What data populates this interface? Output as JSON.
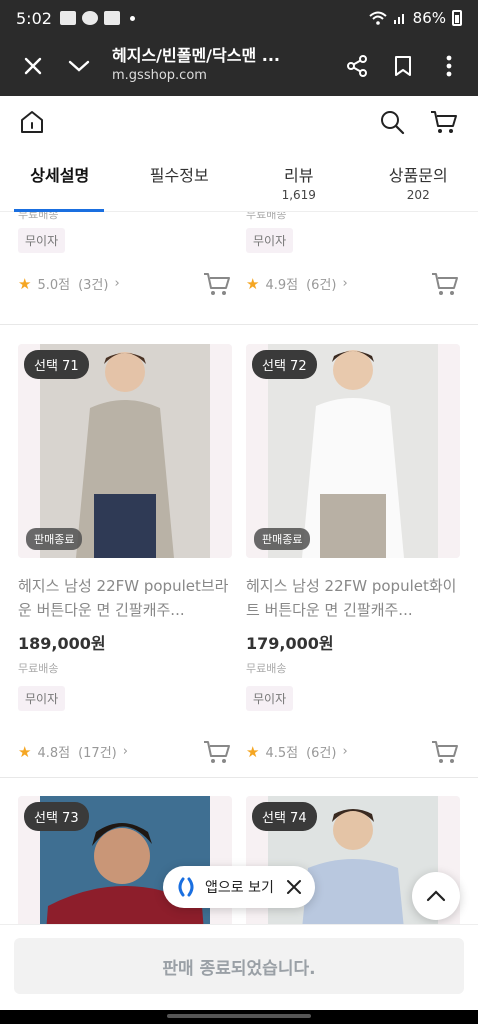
{
  "status_bar": {
    "time": "5:02",
    "battery": "86%"
  },
  "browser": {
    "title": "헤지스/빈폴멘/닥스맨 ...",
    "url": "m.gsshop.com"
  },
  "tabs": [
    {
      "label": "상세설명",
      "count": ""
    },
    {
      "label": "필수정보",
      "count": ""
    },
    {
      "label": "리뷰",
      "count": "1,619"
    },
    {
      "label": "상품문의",
      "count": "202"
    }
  ],
  "prev_row": [
    {
      "ship": "무료배송",
      "tag": "무이자",
      "score": "5.0점",
      "reviews": "(3건)"
    },
    {
      "ship": "무료배송",
      "tag": "무이자",
      "score": "4.9점",
      "reviews": "(6건)"
    }
  ],
  "products": [
    {
      "select_badge": "선택 71",
      "end_badge": "판매종료",
      "name": "헤지스 남성 22FW populet브라운 버튼다운 면 긴팔캐주...",
      "price": "189,000원",
      "ship": "무료배송",
      "tag": "무이자",
      "score": "4.8점",
      "reviews": "(17건)"
    },
    {
      "select_badge": "선택 72",
      "end_badge": "판매종료",
      "name": "헤지스 남성 22FW populet화이트 버튼다운 면 긴팔캐주...",
      "price": "179,000원",
      "ship": "무료배송",
      "tag": "무이자",
      "score": "4.5점",
      "reviews": "(6건)"
    },
    {
      "select_badge": "선택 73"
    },
    {
      "select_badge": "선택 74"
    }
  ],
  "floating": {
    "open_app_label": "앱으로 보기"
  },
  "bottom": {
    "sold_out_label": "판매 종료되었습니다."
  },
  "colors": {
    "accent": "#1a6fe0",
    "star": "#f5a623",
    "chrome": "#2b2b2b"
  }
}
